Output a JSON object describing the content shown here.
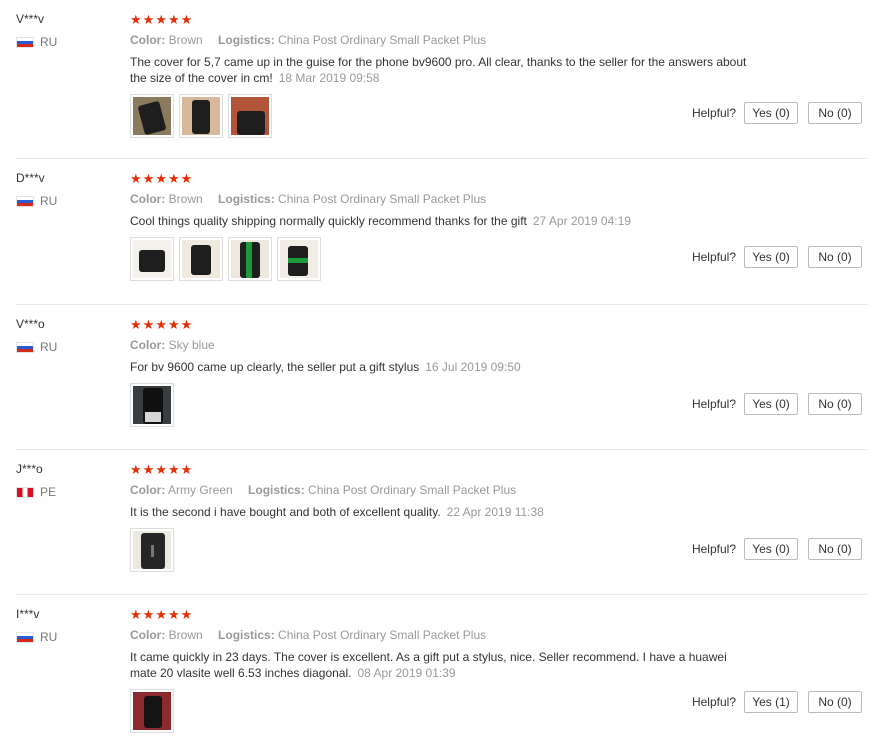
{
  "labels": {
    "color": "Color:",
    "logistics": "Logistics:",
    "helpful": "Helpful?"
  },
  "colors": {
    "star": "#e62e04",
    "divider": "#e8e8e8"
  },
  "reviews": [
    {
      "user": "V***v",
      "country": "RU",
      "rating": 5,
      "color": "Brown",
      "logistics": "China Post Ordinary Small Packet Plus",
      "text": "The cover for 5,7 came up in the guise for the phone bv9600 pro. All clear, thanks to the seller for the answers about the size of the cover in cm!",
      "date": "18 Mar 2019 09:58",
      "photo_count": 3,
      "yes": "Yes (0)",
      "no": "No (0)"
    },
    {
      "user": "D***v",
      "country": "RU",
      "rating": 5,
      "color": "Brown",
      "logistics": "China Post Ordinary Small Packet Plus",
      "text": "Cool things quality shipping normally quickly recommend thanks for the gift",
      "date": "27 Apr 2019 04:19",
      "photo_count": 4,
      "yes": "Yes (0)",
      "no": "No (0)"
    },
    {
      "user": "V***o",
      "country": "RU",
      "rating": 5,
      "color": "Sky blue",
      "logistics": "",
      "text": "For bv 9600 came up clearly, the seller put a gift stylus",
      "date": "16 Jul 2019 09:50",
      "photo_count": 1,
      "yes": "Yes (0)",
      "no": "No (0)"
    },
    {
      "user": "J***o",
      "country": "PE",
      "rating": 5,
      "color": "Army Green",
      "logistics": "China Post Ordinary Small Packet Plus",
      "text": "It is the second i have bought and both of excellent quality.",
      "date": "22 Apr 2019 11:38",
      "photo_count": 1,
      "yes": "Yes (0)",
      "no": "No (0)"
    },
    {
      "user": "I***v",
      "country": "RU",
      "rating": 5,
      "color": "Brown",
      "logistics": "China Post Ordinary Small Packet Plus",
      "text": "It came quickly in 23 days. The cover is excellent. As a gift put a stylus, nice. Seller recommend. I have a huawei mate 20 vlasite well 6.53 inches diagonal.",
      "date": "08 Apr 2019 01:39",
      "photo_count": 1,
      "yes": "Yes (1)",
      "no": "No (0)"
    }
  ]
}
